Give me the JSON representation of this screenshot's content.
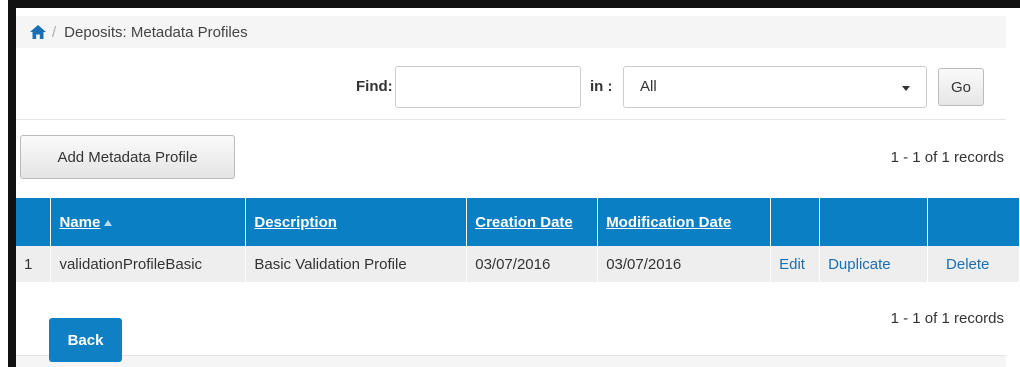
{
  "breadcrumb": {
    "home_icon": "home-icon",
    "title": "Deposits: Metadata Profiles"
  },
  "search": {
    "find_label": "Find:",
    "find_value": "",
    "in_label": "in :",
    "in_selected": "All",
    "go_label": "Go"
  },
  "toolbar": {
    "add_label": "Add Metadata Profile",
    "records_top": "1 - 1 of 1 records"
  },
  "table": {
    "columns": [
      "Name",
      "Description",
      "Creation Date",
      "Modification Date"
    ],
    "rows": [
      {
        "index": "1",
        "name": "validationProfileBasic",
        "description": "Basic Validation Profile",
        "created": "03/07/2016",
        "modified": "03/07/2016",
        "edit": "Edit",
        "duplicate": "Duplicate",
        "delete": "Delete"
      }
    ]
  },
  "footer": {
    "records_bottom": "1 - 1 of 1 records",
    "back_label": "Back"
  },
  "colors": {
    "accent": "#0b7fc3",
    "link": "#1a6fb3",
    "row_bg": "#eeeeee"
  }
}
